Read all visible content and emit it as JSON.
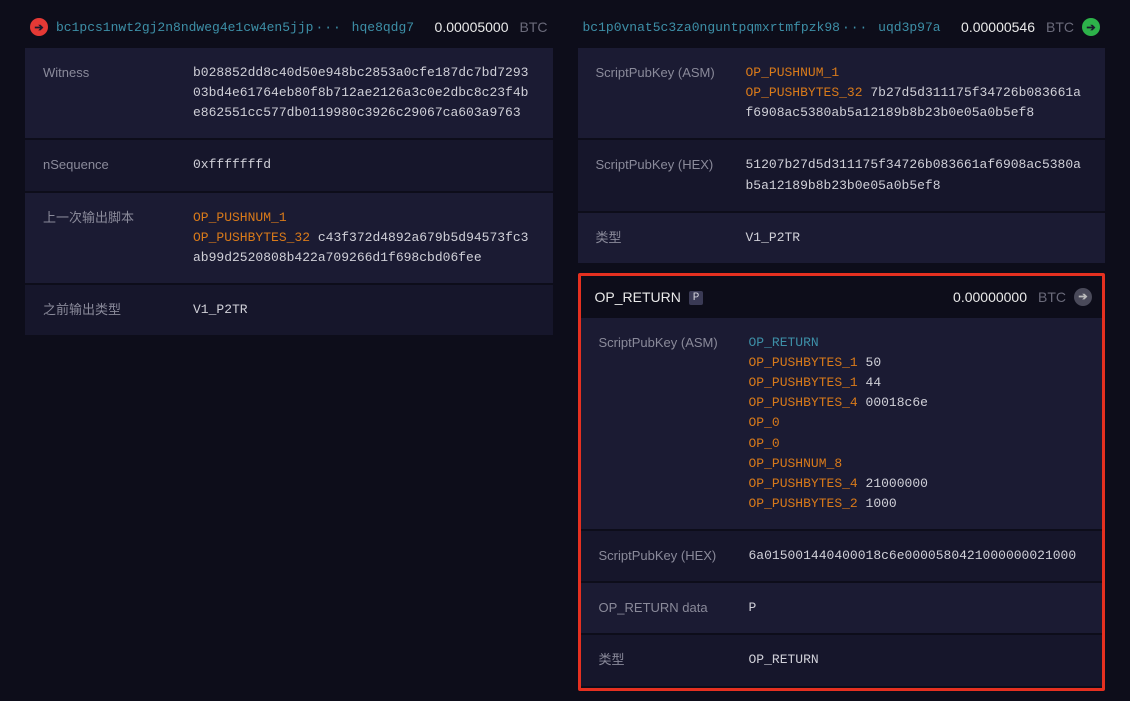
{
  "input": {
    "addr_part1": "bc1pcs1nwt2gj2n8ndweg4e1cw4en5jjp",
    "addr_ellipsis": "···",
    "addr_part2": "hqe8qdg7",
    "amount": "0.00005000",
    "unit": "BTC",
    "rows": {
      "witness": {
        "label": "Witness",
        "value": "b028852dd8c40d50e948bc2853a0cfe187dc7bd729303bd4e61764eb80f8b712ae2126a3c0e2dbc8c23f4be862551cc577db0119980c3926c29067ca603a9763"
      },
      "nsequence": {
        "label": "nSequence",
        "value": "0xfffffffd"
      },
      "prev_out_script": {
        "label": "上一次输出脚本",
        "op1": "OP_PUSHNUM_1",
        "op2": "OP_PUSHBYTES_32",
        "hex": "c43f372d4892a679b5d94573fc3ab99d2520808b422a709266d1f698cbd06fee"
      },
      "prev_out_type": {
        "label": "之前输出类型",
        "value": "V1_P2TR"
      }
    }
  },
  "output1": {
    "addr_part1": "bc1p0vnat5c3za0nguntpqmxrtmfpzk98",
    "addr_ellipsis": "···",
    "addr_part2": "uqd3p97a",
    "amount": "0.00000546",
    "unit": "BTC",
    "rows": {
      "spk_asm": {
        "label": "ScriptPubKey (ASM)",
        "op1": "OP_PUSHNUM_1",
        "op2": "OP_PUSHBYTES_32",
        "hex": "7b27d5d311175f34726b083661af6908ac5380ab5a12189b8b23b0e05a0b5ef8"
      },
      "spk_hex": {
        "label": "ScriptPubKey (HEX)",
        "value": "51207b27d5d311175f34726b083661af6908ac5380ab5a12189b8b23b0e05a0b5ef8"
      },
      "type": {
        "label": "类型",
        "value": "V1_P2TR"
      }
    }
  },
  "output2": {
    "title": "OP_RETURN",
    "badge": "P",
    "amount": "0.00000000",
    "unit": "BTC",
    "rows": {
      "spk_asm": {
        "label": "ScriptPubKey (ASM)",
        "l1": "OP_RETURN",
        "l2_op": "OP_PUSHBYTES_1",
        "l2_v": "50",
        "l3_op": "OP_PUSHBYTES_1",
        "l3_v": "44",
        "l4_op": "OP_PUSHBYTES_4",
        "l4_v": "00018c6e",
        "l5": "OP_0",
        "l6": "OP_0",
        "l7": "OP_PUSHNUM_8",
        "l8_op": "OP_PUSHBYTES_4",
        "l8_v": "21000000",
        "l9_op": "OP_PUSHBYTES_2",
        "l9_v": "1000"
      },
      "spk_hex": {
        "label": "ScriptPubKey (HEX)",
        "value": "6a015001440400018c6e0000580421000000021000"
      },
      "opreturn_data": {
        "label": "OP_RETURN data",
        "value": "P"
      },
      "type": {
        "label": "类型",
        "value": "OP_RETURN"
      }
    }
  }
}
